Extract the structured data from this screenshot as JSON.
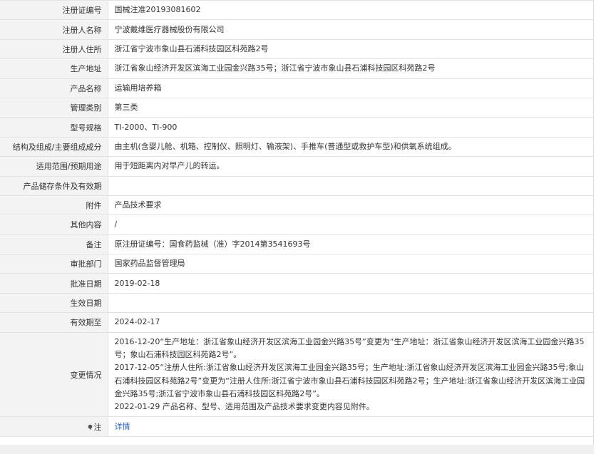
{
  "rows": [
    {
      "label": "注册证编号",
      "value": "国械注准20193081602"
    },
    {
      "label": "注册人名称",
      "value": "宁波戴维医疗器械股份有限公司"
    },
    {
      "label": "注册人住所",
      "value": "浙江省宁波市象山县石浦科技园区科苑路2号"
    },
    {
      "label": "生产地址",
      "value": "浙江省象山经济开发区滨海工业园金兴路35号；浙江省宁波市象山县石浦科技园区科苑路2号"
    },
    {
      "label": "产品名称",
      "value": "运输用培养箱"
    },
    {
      "label": "管理类别",
      "value": "第三类"
    },
    {
      "label": "型号规格",
      "value": "TI-2000、TI-900"
    },
    {
      "label": "结构及组成/主要组成成分",
      "value": "由主机(含婴儿舱、机箱、控制仪、照明灯、输液架)、手推车(普通型或救护车型)和供氧系统组成。"
    },
    {
      "label": "适用范围/预期用途",
      "value": "用于短距离内对早产儿的转运。"
    },
    {
      "label": "产品储存条件及有效期",
      "value": ""
    },
    {
      "label": "附件",
      "value": "产品技术要求"
    },
    {
      "label": "其他内容",
      "value": "/"
    },
    {
      "label": "备注",
      "value": "原注册证编号：国食药监械（准）字2014第3541693号"
    },
    {
      "label": "审批部门",
      "value": "国家药品监督管理局"
    },
    {
      "label": "批准日期",
      "value": "2019-02-18"
    },
    {
      "label": "生效日期",
      "value": ""
    },
    {
      "label": "有效期至",
      "value": "2024-02-17"
    }
  ],
  "changes": {
    "label": "变更情况",
    "entries": [
      "2016-12-20“生产地址：浙江省象山经济开发区滨海工业园金兴路35号”变更为“生产地址：浙江省象山经济开发区滨海工业园金兴路35号；象山石浦科技园区科苑路2号”。",
      "2017-12-05“注册人住所:浙江省象山经济开发区滨海工业园金兴路35号；生产地址:浙江省象山经济开发区滨海工业园金兴路35号;象山石浦科技园区科苑路2号”变更为“注册人住所:浙江省宁波市象山县石浦科技园区科苑路2号；生产地址:浙江省象山经济开发区滨海工业园金兴路35号;浙江省宁波市象山县石浦科技园区科苑路2号”。",
      "2022-01-29 产品名称、型号、适用范围及产品技术要求变更内容见附件。"
    ]
  },
  "note": {
    "icon": "pin-icon",
    "label": "注",
    "link_text": "详情",
    "link_color": "#2f62b4"
  }
}
